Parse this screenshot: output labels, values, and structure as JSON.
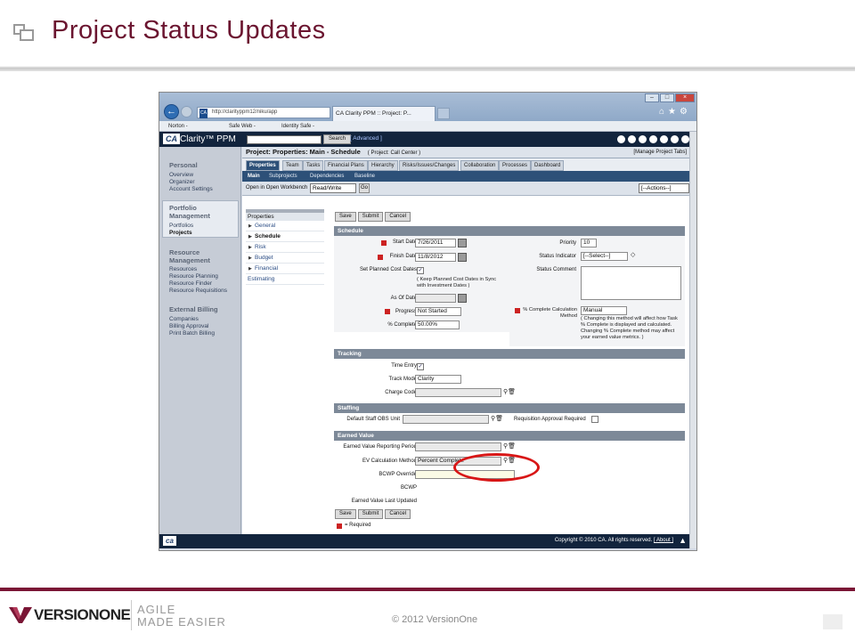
{
  "slide": {
    "title": "Project Status Updates",
    "footer_tag_line1": "AGILE",
    "footer_tag_line2": "MADE EASIER",
    "footer_logo_text": "VERSIONONE",
    "copyright": "© 2012 VersionOne"
  },
  "browser": {
    "url": "http://clarityppm12/niku/app",
    "tab_title": "CA Clarity PPM :: Project: P...",
    "toolbar": {
      "norton": "Norton -",
      "safe_web": "Safe Web -",
      "identity_safe": "Identity Safe -"
    }
  },
  "app": {
    "logo": "CA",
    "name": "Clarity™ PPM",
    "search_button": "Search",
    "advanced_link": "[ Advanced ]"
  },
  "leftnav": {
    "sections": [
      {
        "title": "Personal",
        "items": [
          "Overview",
          "Organizer",
          "Account Settings"
        ]
      },
      {
        "title": "Portfolio Management",
        "title_line1": "Portfolio",
        "title_line2": "Management",
        "items": [
          "Portfolios",
          "Projects"
        ]
      },
      {
        "title": "Resource Management",
        "title_line1": "Resource",
        "title_line2": "Management",
        "items": [
          "Resources",
          "Resource Planning",
          "Resource Finder",
          "Resource Requisitions"
        ]
      },
      {
        "title": "External Billing",
        "items": [
          "Companies",
          "Billing Approval",
          "Print Batch Billing"
        ]
      }
    ]
  },
  "page": {
    "header": "Project: Properties: Main - Schedule",
    "header_context": "( Project: Call Center )",
    "manage_tabs": "[Manage Project Tabs]",
    "tabs": [
      "Properties",
      "Team",
      "Tasks",
      "Financial Plans",
      "Hierarchy",
      "Risks/Issues/Changes",
      "Collaboration",
      "Processes",
      "Dashboard"
    ],
    "subtabs": [
      "Main",
      "Subprojects",
      "Dependencies",
      "Baseline"
    ],
    "workbench_label": "Open in Open Workbench",
    "workbench_value": "Read/Write",
    "go": "Go",
    "actions": "[--Actions--]"
  },
  "props_menu": {
    "header": "Properties",
    "items": [
      "General",
      "Schedule",
      "Risk",
      "Budget",
      "Financial"
    ],
    "estimating": "Estimating"
  },
  "buttons": {
    "save": "Save",
    "submit": "Submit",
    "cancel": "Cancel"
  },
  "schedule": {
    "section": "Schedule",
    "start_date_label": "Start Date",
    "start_date": "7/26/2011",
    "finish_date_label": "Finish Date",
    "finish_date": "11/8/2012",
    "planned_cost_label": "Set Planned Cost Dates",
    "planned_cost_note": "( Keep Planned Cost Dates in Sync with Investment Dates )",
    "asof_label": "As Of Date",
    "progress_label": "Progress",
    "progress_value": "Not Started",
    "pct_label": "% Complete",
    "pct_value": "50.00%",
    "priority_label": "Priority",
    "priority_value": "10",
    "status_indicator_label": "Status Indicator",
    "status_indicator_value": "[--Select--]",
    "status_comment_label": "Status Comment",
    "calc_label": "% Complete Calculation Method",
    "calc_value": "Manual",
    "calc_note": "( Changing this method will affect how Task % Complete is displayed and calculated. Changing % Complete method may affect your earned value metrics. )"
  },
  "tracking": {
    "section": "Tracking",
    "time_entry_label": "Time Entry",
    "track_mode_label": "Track Mode",
    "track_mode_value": "Clarity",
    "charge_code_label": "Charge Code"
  },
  "staffing": {
    "section": "Staffing",
    "obs_label": "Default Staff OBS Unit",
    "req_approval_label": "Requisition Approval Required"
  },
  "earned_value": {
    "section": "Earned Value",
    "ev_period_label": "Earned Value Reporting Period",
    "ev_calc_label": "EV Calculation Method",
    "ev_calc_value": "Percent Complete",
    "bcwp_override_label": "BCWP Override",
    "bcwp_label": "BCWP",
    "ev_last_updated_label": "Earned Value Last Updated"
  },
  "required_note": "= Required",
  "statusbar": {
    "logo": "ca",
    "copyright": "Copyright © 2010 CA. All rights reserved.",
    "about": "[ About ]"
  },
  "colors": {
    "title": "#6b1530",
    "accent_bar": "#7a1535",
    "clarity_nav": "#12243d",
    "tab_active": "#2d5078",
    "highlight": "#d81616"
  }
}
